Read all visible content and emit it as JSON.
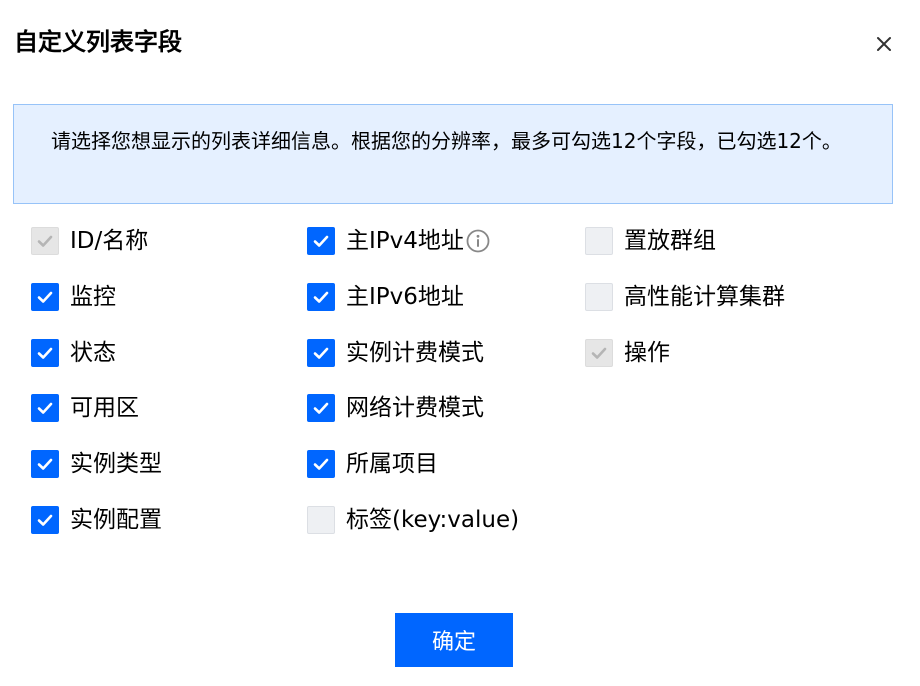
{
  "dialog": {
    "title": "自定义列表字段",
    "notice": "请选择您想显示的列表详细信息。根据您的分辨率，最多可勾选12个字段，已勾选12个。",
    "confirm_label": "确定"
  },
  "columns": [
    [
      {
        "label": "ID/名称",
        "state": "disabled-checked"
      },
      {
        "label": "监控",
        "state": "checked"
      },
      {
        "label": "状态",
        "state": "checked"
      },
      {
        "label": "可用区",
        "state": "checked"
      },
      {
        "label": "实例类型",
        "state": "checked"
      },
      {
        "label": "实例配置",
        "state": "checked"
      }
    ],
    [
      {
        "label": "主IPv4地址",
        "state": "checked",
        "icon": "info-icon"
      },
      {
        "label": "主IPv6地址",
        "state": "checked"
      },
      {
        "label": "实例计费模式",
        "state": "checked"
      },
      {
        "label": "网络计费模式",
        "state": "checked"
      },
      {
        "label": "所属项目",
        "state": "checked"
      },
      {
        "label": "标签(key:value)",
        "state": "unchecked"
      }
    ],
    [
      {
        "label": "置放群组",
        "state": "unchecked"
      },
      {
        "label": "高性能计算集群",
        "state": "unchecked"
      },
      {
        "label": "操作",
        "state": "disabled-checked"
      }
    ]
  ],
  "colors": {
    "accent": "#0066ff",
    "notice_bg": "#e5f0ff",
    "notice_border": "#97c3f8"
  }
}
